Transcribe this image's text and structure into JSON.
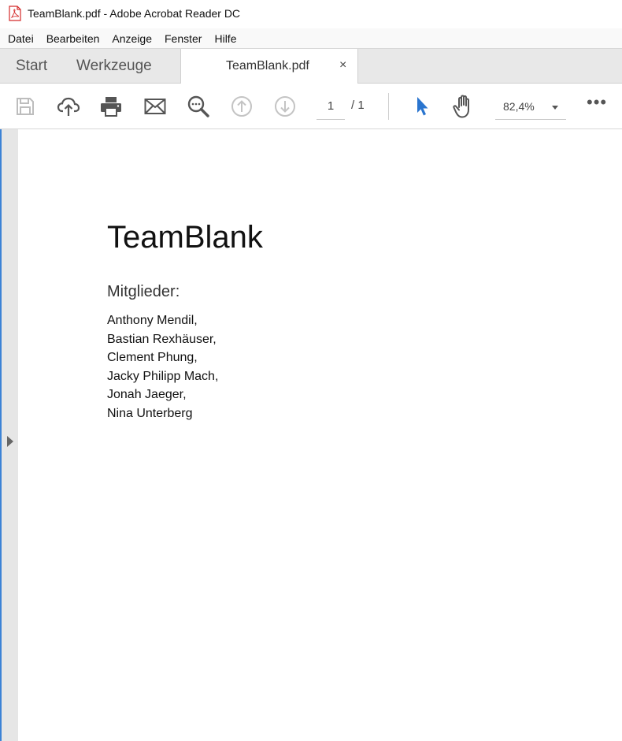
{
  "window": {
    "title": "TeamBlank.pdf - Adobe Acrobat Reader DC",
    "app_icon": "pdf-file-icon"
  },
  "menubar": {
    "items": [
      "Datei",
      "Bearbeiten",
      "Anzeige",
      "Fenster",
      "Hilfe"
    ]
  },
  "tabs": {
    "start": "Start",
    "tools": "Werkzeuge",
    "document": "TeamBlank.pdf",
    "close": "×"
  },
  "toolbar": {
    "icons": [
      "save-icon",
      "cloud-upload-icon",
      "print-icon",
      "mail-icon",
      "find-icon",
      "page-up-icon",
      "page-down-icon",
      "select-cursor-icon",
      "hand-tool-icon",
      "more-icon"
    ],
    "page_current": "1",
    "page_total": "/ 1",
    "zoom": "82,4%",
    "more": "•••",
    "accent_color": "#2a75cf"
  },
  "document": {
    "title": "TeamBlank",
    "subtitle": "Mitglieder:",
    "members": [
      "Anthony Mendil,",
      "Bastian Rexhäuser,",
      "Clement Phung,",
      "Jacky Philipp Mach,",
      "Jonah Jaeger,",
      "Nina Unterberg"
    ]
  }
}
